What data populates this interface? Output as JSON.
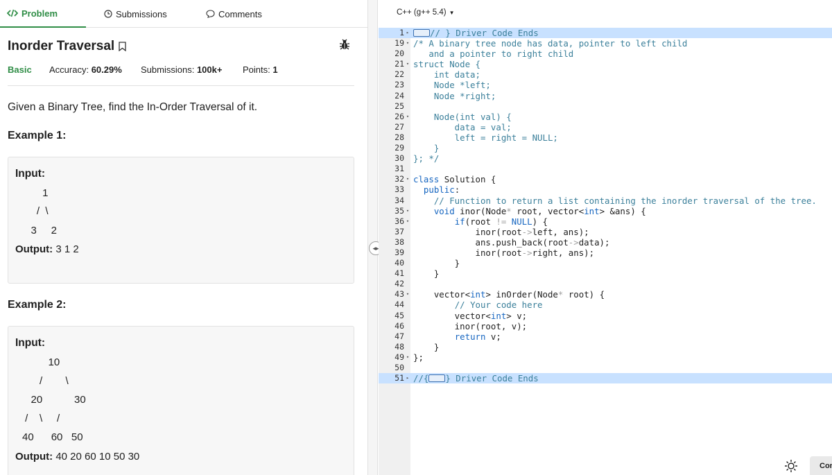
{
  "tabs": [
    {
      "label": "Problem",
      "icon": "code-icon"
    },
    {
      "label": "Submissions",
      "icon": "clock-icon"
    },
    {
      "label": "Comments",
      "icon": "comment-icon"
    }
  ],
  "problem": {
    "title": "Inorder Traversal",
    "difficulty": "Basic",
    "accuracy_label": "Accuracy:",
    "accuracy_value": "60.29%",
    "submissions_label": "Submissions:",
    "submissions_value": "100k+",
    "points_label": "Points:",
    "points_value": "1",
    "statement": "Given a Binary Tree, find the In-Order Traversal of it."
  },
  "examples": [
    {
      "heading": "Example 1:",
      "input_label": "Input:",
      "tree_lines": [
        "       1",
        "     /  \\",
        "   3     2"
      ],
      "output_label": "Output:",
      "output_value": "3 1 2"
    },
    {
      "heading": "Example 2:",
      "input_label": "Input:",
      "tree_lines": [
        "         10",
        "      /        \\",
        "   20           30",
        " /    \\     /",
        "40      60   50"
      ],
      "output_label": "Output:",
      "output_value": "40 20 60 10 50 30"
    }
  ],
  "editor": {
    "language": "C++ (g++ 5.4)",
    "lines": [
      {
        "n": "1",
        "fold": "▸",
        "hl": true,
        "html": "<span class=\"pill\"></span><span class=\"cm\">// } Driver Code Ends</span>"
      },
      {
        "n": "19",
        "fold": "▾",
        "hl": false,
        "html": "<span class=\"cm\">/* A binary tree node has data, pointer to left child</span>"
      },
      {
        "n": "20",
        "fold": "",
        "hl": false,
        "html": "<span class=\"cm\">   and a pointer to right child</span>"
      },
      {
        "n": "21",
        "fold": "▾",
        "hl": false,
        "html": "<span class=\"cm\">struct Node {</span>"
      },
      {
        "n": "22",
        "fold": "",
        "hl": false,
        "html": "<span class=\"cm\">    int data;</span>"
      },
      {
        "n": "23",
        "fold": "",
        "hl": false,
        "html": "<span class=\"cm\">    Node *left;</span>"
      },
      {
        "n": "24",
        "fold": "",
        "hl": false,
        "html": "<span class=\"cm\">    Node *right;</span>"
      },
      {
        "n": "25",
        "fold": "",
        "hl": false,
        "html": ""
      },
      {
        "n": "26",
        "fold": "▾",
        "hl": false,
        "html": "<span class=\"cm\">    Node(int val) {</span>"
      },
      {
        "n": "27",
        "fold": "",
        "hl": false,
        "html": "<span class=\"cm\">        data = val;</span>"
      },
      {
        "n": "28",
        "fold": "",
        "hl": false,
        "html": "<span class=\"cm\">        left = right = NULL;</span>"
      },
      {
        "n": "29",
        "fold": "",
        "hl": false,
        "html": "<span class=\"cm\">    }</span>"
      },
      {
        "n": "30",
        "fold": "",
        "hl": false,
        "html": "<span class=\"cm\">}; */</span>"
      },
      {
        "n": "31",
        "fold": "",
        "hl": false,
        "html": ""
      },
      {
        "n": "32",
        "fold": "▾",
        "hl": false,
        "html": "<span class=\"kw\">class</span> Solution {"
      },
      {
        "n": "33",
        "fold": "",
        "hl": false,
        "html": "  <span class=\"kw\">public</span>:"
      },
      {
        "n": "34",
        "fold": "",
        "hl": false,
        "html": "    <span class=\"cm\">// Function to return a list containing the inorder traversal of the tree.</span>"
      },
      {
        "n": "35",
        "fold": "▾",
        "hl": false,
        "html": "    <span class=\"ty\">void</span> inor(Node<span class=\"op\">*</span> root, vector&lt;<span class=\"ty\">int</span>&gt; &amp;ans) {"
      },
      {
        "n": "36",
        "fold": "▾",
        "hl": false,
        "html": "        <span class=\"kw\">if</span>(root <span class=\"op\">!=</span> <span class=\"nl\">NULL</span>) {"
      },
      {
        "n": "37",
        "fold": "",
        "hl": false,
        "html": "            inor(root<span class=\"op\">-&gt;</span>left, ans);"
      },
      {
        "n": "38",
        "fold": "",
        "hl": false,
        "html": "            ans.push_back(root<span class=\"op\">-&gt;</span>data);"
      },
      {
        "n": "39",
        "fold": "",
        "hl": false,
        "html": "            inor(root<span class=\"op\">-&gt;</span>right, ans);"
      },
      {
        "n": "40",
        "fold": "",
        "hl": false,
        "html": "        }"
      },
      {
        "n": "41",
        "fold": "",
        "hl": false,
        "html": "    }"
      },
      {
        "n": "42",
        "fold": "",
        "hl": false,
        "html": ""
      },
      {
        "n": "43",
        "fold": "▾",
        "hl": false,
        "html": "    vector&lt;<span class=\"ty\">int</span>&gt; inOrder(Node<span class=\"op\">*</span> root) {"
      },
      {
        "n": "44",
        "fold": "",
        "hl": false,
        "html": "        <span class=\"cm\">// Your code here</span>"
      },
      {
        "n": "45",
        "fold": "",
        "hl": false,
        "html": "        vector&lt;<span class=\"ty\">int</span>&gt; v;"
      },
      {
        "n": "46",
        "fold": "",
        "hl": false,
        "html": "        inor(root, v);"
      },
      {
        "n": "47",
        "fold": "",
        "hl": false,
        "html": "        <span class=\"kw\">return</span> v;"
      },
      {
        "n": "48",
        "fold": "",
        "hl": false,
        "html": "    }"
      },
      {
        "n": "49",
        "fold": "▾",
        "hl": false,
        "html": "};"
      },
      {
        "n": "50",
        "fold": "",
        "hl": false,
        "html": ""
      },
      {
        "n": "51",
        "fold": "▸",
        "hl": true,
        "html": "<span class=\"cm\">//{</span><span class=\"pill\"></span><span class=\"cm\">} Driver Code Ends</span>"
      }
    ]
  },
  "footer": {
    "settings_icon": "sun-settings-icon",
    "button_label": "Con"
  },
  "colors": {
    "accent": "#2f8d46",
    "highlight": "#c8e1ff",
    "keyword": "#1565c0",
    "comment": "#3a7f9a"
  }
}
